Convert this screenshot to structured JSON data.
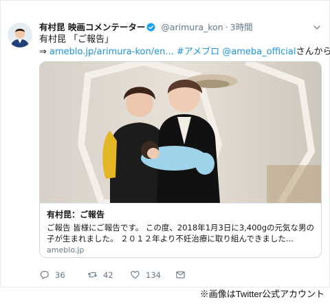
{
  "tweet": {
    "display_name": "有村昆 映画コメンテーター",
    "handle": "@arimura_kon",
    "separator": "·",
    "time": "3時間",
    "text_line1": "有村昆 「ご報告」",
    "arrow": "⇒",
    "link_url": "ameblo.jp/arimura-kon/en...",
    "hashtag": "#アメブロ",
    "mention": "@ameba_official",
    "suffix": "さんから"
  },
  "card": {
    "title": "有村昆：ご報告",
    "description": "ご報告 皆様にご報告です。 この度、2018年1月3日に3,400gの元気な男の子が生まれました。 ２０１２年より不妊治療に取り組んできました...",
    "domain": "ameblo.jp"
  },
  "actions": {
    "replies": "36",
    "retweets": "42",
    "likes": "134"
  },
  "icons": {
    "verified": "verified-badge-icon",
    "chevron": "chevron-down-icon",
    "reply": "reply-icon",
    "retweet": "retweet-icon",
    "like": "heart-icon",
    "message": "envelope-icon"
  },
  "credit": "※画像はTwitter公式アカウント",
  "colors": {
    "link": "#1b95e0",
    "muted": "#657786",
    "verified": "#1da1f2"
  }
}
